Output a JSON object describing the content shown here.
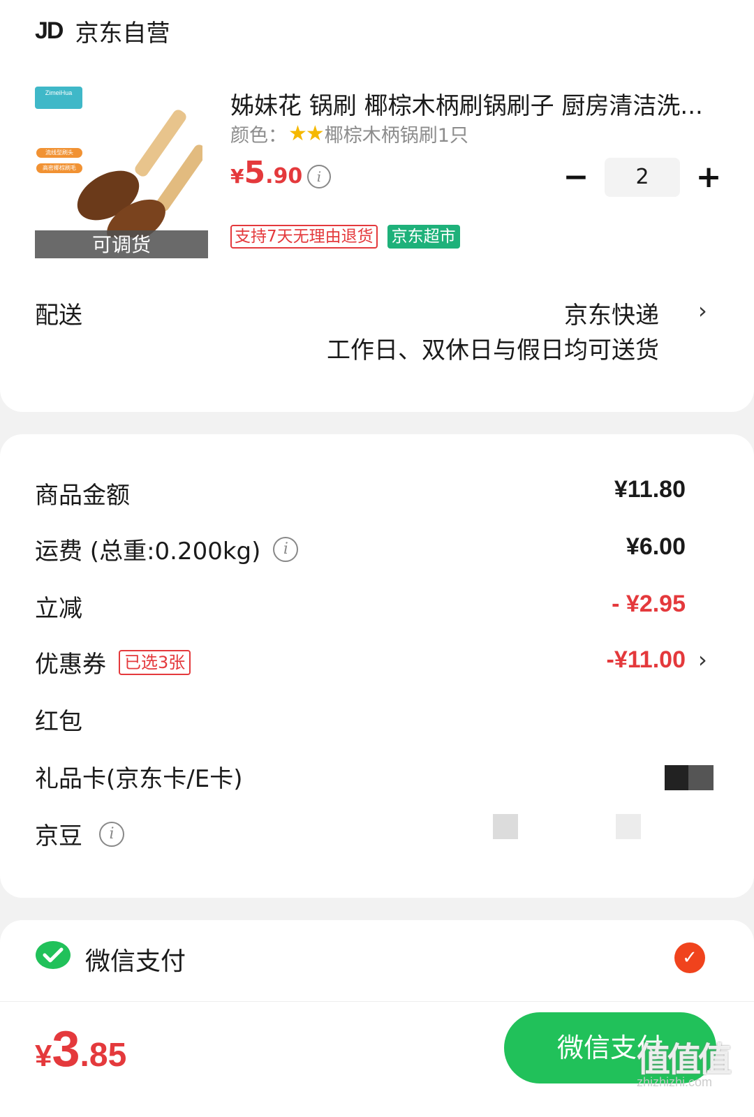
{
  "store": {
    "logo": "JD",
    "name": "京东自营"
  },
  "product": {
    "image_overlay": "可调货",
    "image_brand": "ZimeiHua",
    "image_tags": [
      "流线型刷头",
      "高密椰棕刷毛"
    ],
    "title": "姊妹花 锅刷 椰棕木柄刷锅刷子 厨房清洁洗...",
    "variant_label": "颜色：",
    "variant_value": "椰棕木柄锅刷1只",
    "price_currency": "¥",
    "price_int": "5",
    "price_dec": ".90",
    "quantity": "2",
    "badges": [
      "支持7天无理由退货",
      "京东超市"
    ]
  },
  "delivery": {
    "label": "配送",
    "value": "京东快递",
    "sub": "工作日、双休日与假日均可送货"
  },
  "summary": {
    "goods_label": "商品金额",
    "goods_value": "¥11.80",
    "shipping_label": "运费 (总重:0.200kg)",
    "shipping_value": "¥6.00",
    "discount_label": "立减",
    "discount_value": "- ¥2.95",
    "coupon_label": "优惠券",
    "coupon_badge": "已选3张",
    "coupon_value": "-¥11.00",
    "redpacket_label": "红包",
    "giftcard_label": "礼品卡(京东卡/E卡)",
    "jingdou_label": "京豆"
  },
  "payment": {
    "method": "微信支付",
    "total_currency": "¥",
    "total_int": "3",
    "total_dec": ".85",
    "pay_button": "微信支付",
    "watermark": "值值值",
    "watermark_url": "zhizhizhi.com"
  },
  "colors": {
    "accent_red": "#e4393c",
    "wechat_green": "#21c15a",
    "market_green": "#1eb17a"
  }
}
